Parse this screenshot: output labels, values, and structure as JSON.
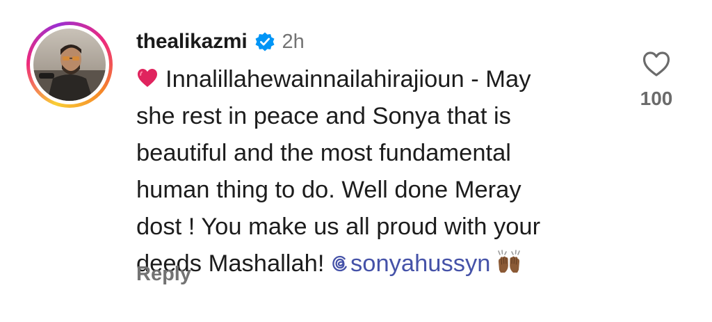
{
  "comment": {
    "username": "thealikazmi",
    "verified_icon": "verified-badge-icon",
    "time_ago": "2h",
    "lines": {
      "l1": "Innalillahewainnailahirajioun - May",
      "l2": "she rest in peace and Sonya that is",
      "l3": "beautiful and the most fundamental",
      "l4": "human thing to do. Well done Meray",
      "l5": "dost ! You make us all proud with your",
      "l6": "deeds Mashallah!"
    },
    "mention": "sonyahussyn",
    "reply_label": "Reply",
    "like_count": "100"
  },
  "colors": {
    "mention": "#4552a8",
    "verified": "#0095f6",
    "secondary_text": "#737373",
    "heart_emoji": "#e0245e"
  },
  "icons": {
    "leading_emoji": "red-heart-emoji",
    "trailing_emoji": "raising-hands-emoji",
    "like": "heart-outline-icon",
    "mention_prefix": "threads-at-icon"
  }
}
